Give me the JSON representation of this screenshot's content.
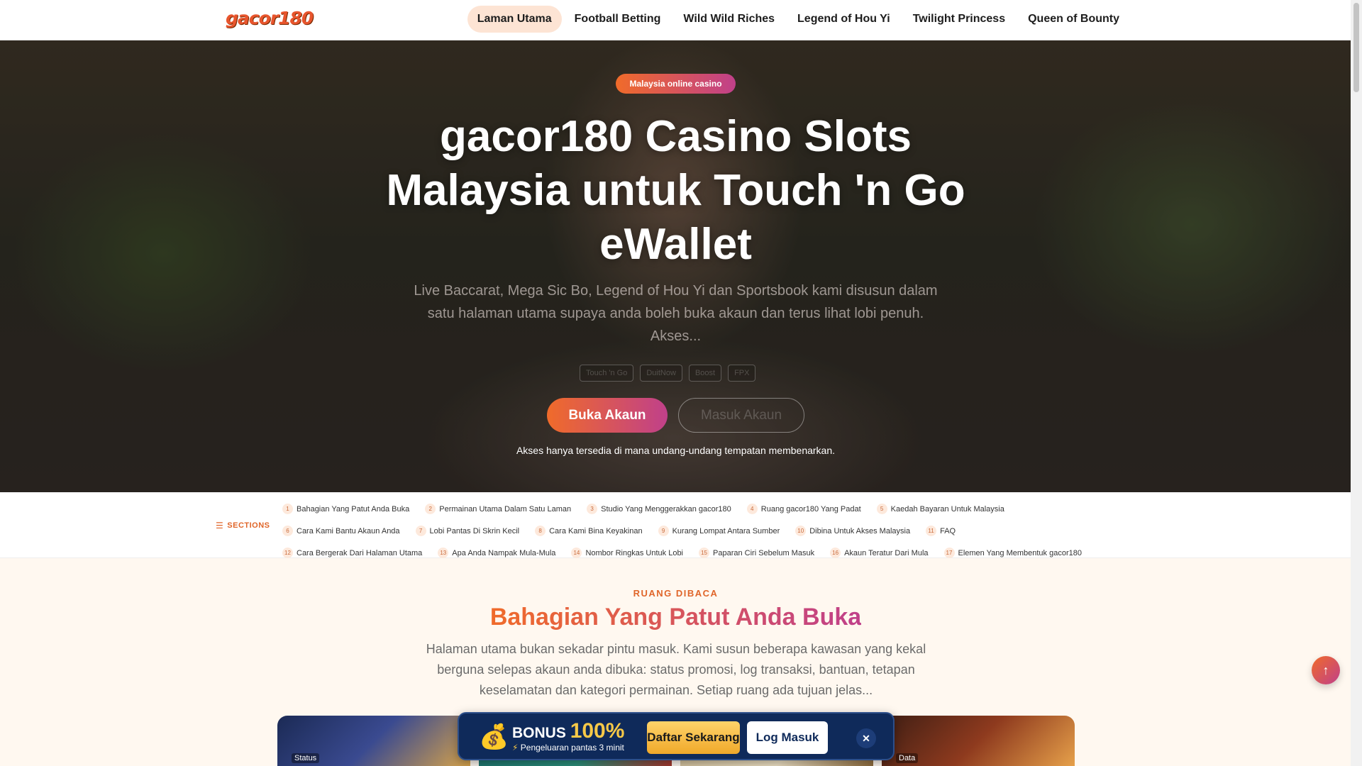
{
  "header": {
    "logo": "gacor180",
    "nav": [
      {
        "label": "Laman Utama",
        "active": true
      },
      {
        "label": "Football Betting"
      },
      {
        "label": "Wild Wild Riches"
      },
      {
        "label": "Legend of Hou Yi"
      },
      {
        "label": "Twilight Princess"
      },
      {
        "label": "Queen of Bounty"
      }
    ]
  },
  "hero": {
    "badge": "Malaysia online casino",
    "title": "gacor180 Casino Slots Malaysia untuk Touch 'n Go eWallet",
    "description": "Live Baccarat, Mega Sic Bo, Legend of Hou Yi dan Sportsbook kami disusun dalam satu halaman utama supaya anda boleh buka akaun dan terus lihat lobi penuh. Akses...",
    "chips": [
      "Touch 'n Go",
      "DuitNow",
      "Boost",
      "FPX"
    ],
    "primary_button": "Buka Akaun",
    "secondary_button": "Masuk Akaun",
    "note": "Akses hanya tersedia di mana undang-undang tempatan membenarkan."
  },
  "sections": {
    "label": "SECTIONS",
    "rows": [
      [
        {
          "num": "1",
          "label": "Bahagian Yang Patut Anda Buka"
        },
        {
          "num": "2",
          "label": "Permainan Utama Dalam Satu Laman"
        },
        {
          "num": "3",
          "label": "Studio Yang Menggerakkan gacor180"
        },
        {
          "num": "4",
          "label": "Ruang gacor180 Yang Padat"
        },
        {
          "num": "5",
          "label": "Kaedah Bayaran Untuk Malaysia"
        }
      ],
      [
        {
          "num": "6",
          "label": "Cara Kami Bantu Akaun Anda"
        },
        {
          "num": "7",
          "label": "Lobi Pantas Di Skrin Kecil"
        },
        {
          "num": "8",
          "label": "Cara Kami Bina Keyakinan"
        },
        {
          "num": "9",
          "label": "Kurang Lompat Antara Sumber"
        },
        {
          "num": "10",
          "label": "Dibina Untuk Akses Malaysia"
        },
        {
          "num": "11",
          "label": "FAQ"
        }
      ],
      [
        {
          "num": "12",
          "label": "Cara Bergerak Dari Halaman Utama"
        },
        {
          "num": "13",
          "label": "Apa Anda Nampak Mula-Mula"
        },
        {
          "num": "14",
          "label": "Nombor Ringkas Untuk Lobi"
        },
        {
          "num": "15",
          "label": "Paparan Ciri Sebelum Masuk"
        },
        {
          "num": "16",
          "label": "Akaun Teratur Dari Mula"
        },
        {
          "num": "17",
          "label": "Elemen Yang Membentuk gacor180"
        }
      ]
    ]
  },
  "content": {
    "kicker": "RUANG DIBACA",
    "title": "Bahagian Yang Patut Anda Buka",
    "description": "Halaman utama bukan sekadar pintu masuk. Kami susun beberapa kawasan yang kekal berguna selepas akaun anda dibuka: status promosi, log transaksi, bantuan, tetapan keselamatan dan kategori permainan. Setiap ruang ada tujuan jelas...",
    "cards": [
      {
        "label": "Status"
      },
      {
        "label": ""
      },
      {
        "label": ""
      },
      {
        "label": "Data"
      }
    ]
  },
  "bonus_bar": {
    "title_word": "BONUS",
    "percent": "100%",
    "subtitle": "Pengeluaran pantas 3 minit",
    "register_button": "Daftar Sekarang",
    "login_button": "Log Masuk",
    "close": "✕"
  },
  "back_to_top": "↑",
  "colors": {
    "accent_orange": "#f06b2a",
    "accent_magenta": "#c0408a",
    "bonus_navy": "#0f2a5a",
    "bonus_gold": "#f7c948"
  }
}
